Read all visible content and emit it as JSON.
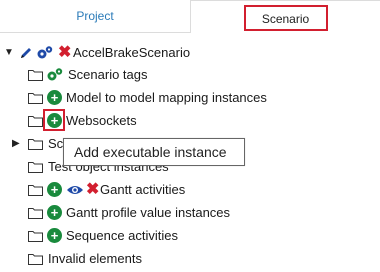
{
  "tabs": {
    "project": "Project",
    "scenario": "Scenario"
  },
  "tree": {
    "root": "AccelBrakeScenario",
    "items": [
      {
        "label": "Scenario tags"
      },
      {
        "label": "Model to model mapping instances"
      },
      {
        "label": "Websockets"
      },
      {
        "label": "Sc"
      },
      {
        "label": "Test object instances"
      },
      {
        "label": "Gantt activities"
      },
      {
        "label": "Gantt profile value instances"
      },
      {
        "label": "Sequence activities"
      },
      {
        "label": "Invalid elements"
      }
    ]
  },
  "tooltip": {
    "text": "Add executable instance"
  },
  "colors": {
    "accent_red": "#d21f2f",
    "green": "#198a3d",
    "blue": "#1f4aa8"
  },
  "icons": [
    "pencil-icon",
    "gear-icon",
    "close-icon",
    "plus-circle-icon",
    "eye-icon",
    "folder-icon",
    "expand-icon",
    "collapse-icon"
  ]
}
